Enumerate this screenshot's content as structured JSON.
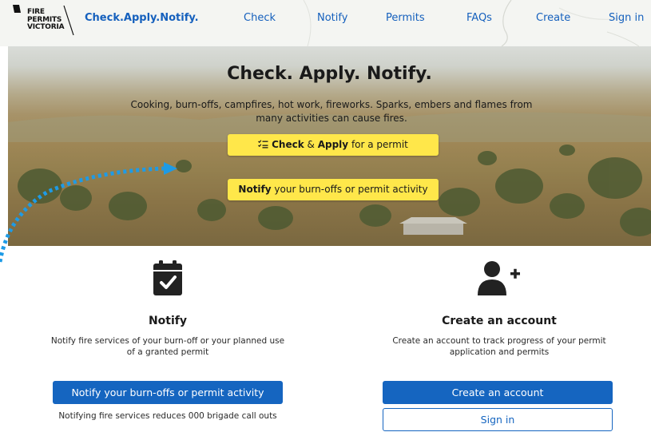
{
  "header": {
    "logo_lines": [
      "FIRE",
      "PERMITS",
      "VICTORIA"
    ],
    "brand": "Check.Apply.Notify.",
    "nav": [
      "Check",
      "Notify",
      "Permits",
      "FAQs",
      "Create",
      "Sign in"
    ]
  },
  "hero": {
    "title": "Check. Apply. Notify.",
    "subtitle": "Cooking, burn-offs, campfires, hot work, fireworks. Sparks, embers and flames from many activities can cause fires.",
    "check_button": {
      "bold1": "Check",
      "amp": " & ",
      "bold2": "Apply",
      "rest": " for a permit"
    },
    "notify_button": {
      "bold": "Notify",
      "rest": " your burn-offs or permit activity"
    }
  },
  "notify_section": {
    "icon": "calendar-check-icon",
    "title": "Notify",
    "description": "Notify fire services of your burn-off or your planned use of a granted permit",
    "button": "Notify your burn-offs or permit activity",
    "note": "Notifying fire services reduces 000 brigade call outs"
  },
  "account_section": {
    "icon": "user-plus-icon",
    "title": "Create an account",
    "description": "Create an account to track progress of your permit application and permits",
    "create_button": "Create an account",
    "signin_button": "Sign in"
  },
  "colors": {
    "link_blue": "#1560bd",
    "primary_blue": "#1565c0",
    "highlight_yellow": "#ffe74a",
    "dotted_arrow": "#1e9be6"
  }
}
